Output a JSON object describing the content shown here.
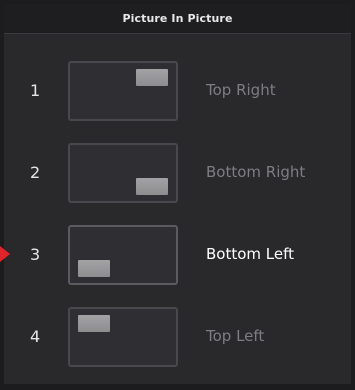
{
  "header": {
    "title": "Picture In Picture"
  },
  "options": [
    {
      "number": "1",
      "label": "Top Right",
      "position": "top-right",
      "selected": false
    },
    {
      "number": "2",
      "label": "Bottom Right",
      "position": "bottom-right",
      "selected": false
    },
    {
      "number": "3",
      "label": "Bottom Left",
      "position": "bottom-left",
      "selected": true
    },
    {
      "number": "4",
      "label": "Top Left",
      "position": "top-left",
      "selected": false
    }
  ],
  "colors": {
    "selection_indicator": "#e0242a",
    "selected_label": "#ffffff",
    "unselected_label": "#7d7d82"
  }
}
